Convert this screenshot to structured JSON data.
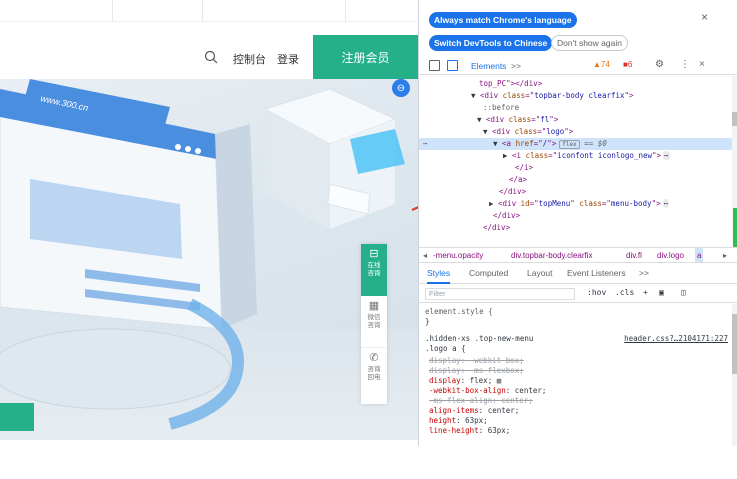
{
  "site": {
    "header_links": [
      "控制台",
      "登录"
    ],
    "register_label": "注册会员",
    "hero_url_text": "www.300.cn",
    "float_bar": [
      {
        "icon": "chat-icon",
        "glyph": "⊟",
        "label_line1": "在线",
        "label_line2": "咨询"
      },
      {
        "icon": "qr-icon",
        "glyph": "▦",
        "label_line1": "微信",
        "label_line2": "咨询"
      },
      {
        "icon": "phone-icon",
        "glyph": "✆",
        "label_line1": "咨询",
        "label_line2": "回电"
      }
    ]
  },
  "devtools": {
    "banner": {
      "always_match": "Always match Chrome's language",
      "switch_chinese": "Switch DevTools to Chinese",
      "dont_show": "Don't show again",
      "close": "×"
    },
    "toolbar": {
      "elements_tab": "Elements",
      "more": ">>",
      "warnings": "▲74",
      "errors": "■6",
      "settings": "⚙",
      "menu": "⋮",
      "close": "×"
    },
    "dom": [
      {
        "indent": 60,
        "html": "top_PC\"></div>"
      },
      {
        "indent": 52,
        "tri": "▼",
        "tag": "div",
        "attrs": [
          [
            "class",
            "topbar-body clearfix"
          ]
        ],
        "close": ">"
      },
      {
        "indent": 64,
        "pseudo": "::before"
      },
      {
        "indent": 58,
        "tri": "▼",
        "tag": "div",
        "attrs": [
          [
            "class",
            "fl"
          ]
        ],
        "close": ">"
      },
      {
        "indent": 64,
        "tri": "▼",
        "tag": "div",
        "attrs": [
          [
            "class",
            "logo"
          ]
        ],
        "close": ">"
      },
      {
        "indent": 74,
        "tri": "▼",
        "tag": "a",
        "attrs": [
          [
            "href",
            "/"
          ]
        ],
        "close": ">",
        "flex": "flex",
        "eq": "== $0",
        "selected": true
      },
      {
        "indent": 84,
        "tri": "▶",
        "tag": "i",
        "attrs": [
          [
            "class",
            "iconfont iconlogo_new"
          ]
        ],
        "close": ">",
        "dots": "⋯"
      },
      {
        "indent": 96,
        "html": "</i>"
      },
      {
        "indent": 90,
        "html": "</a>"
      },
      {
        "indent": 80,
        "html": "</div>"
      },
      {
        "indent": 70,
        "tri": "▶",
        "tag": "div",
        "attrs": [
          [
            "id",
            "topMenu"
          ],
          [
            "class",
            "menu-body"
          ]
        ],
        "close": ">",
        "dots": "⋯"
      },
      {
        "indent": 74,
        "html": "</div>"
      },
      {
        "indent": 64,
        "html": "</div>"
      }
    ],
    "breadcrumbs": [
      "◂",
      "-menu.opacity",
      "div.topbar-body.clearfix",
      "div.fl",
      "div.logo",
      "a",
      "▸"
    ],
    "style_tabs": [
      "Styles",
      "Computed",
      "Layout",
      "Event Listeners",
      ">>"
    ],
    "filter_placeholder": "Filter",
    "filter_tools": [
      ":hov",
      ".cls",
      "+",
      "▣",
      "◫"
    ],
    "rules": {
      "element_style": "element.style {",
      "close_brace": "}",
      "selector_line1": ".hidden-xs .top-new-menu",
      "selector_line2": ".logo a {",
      "source": "header.css?…2104171:227",
      "decls": [
        {
          "prop": "display",
          "value": "-webkit-box",
          "struck": true
        },
        {
          "prop": "display",
          "value": "-ms-flexbox",
          "struck": true
        },
        {
          "prop": "display",
          "value": "flex",
          "struck": false
        },
        {
          "prop": "-webkit-box-align",
          "value": "center",
          "struck": false
        },
        {
          "prop": "-ms-flex-align",
          "value": "center",
          "struck": true
        },
        {
          "prop": "align-items",
          "value": "center",
          "struck": false
        },
        {
          "prop": "height",
          "value": "63px",
          "struck": false
        },
        {
          "prop": "line-height",
          "value": "63px",
          "struck": false
        }
      ]
    }
  }
}
